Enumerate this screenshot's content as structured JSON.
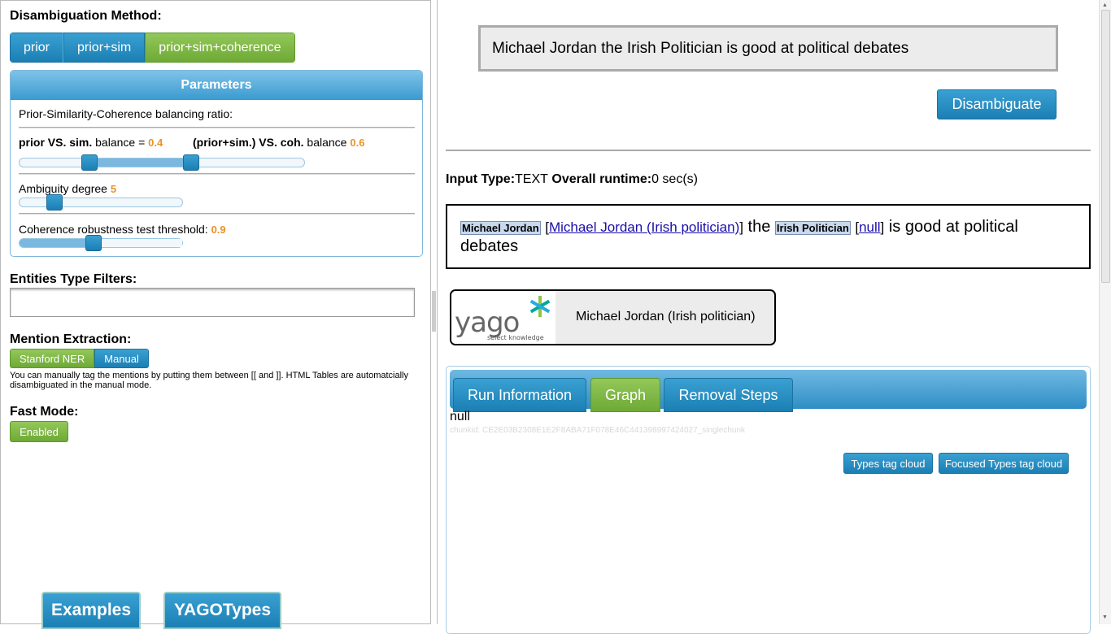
{
  "left": {
    "method_title": "Disambiguation Method:",
    "methods": [
      "prior",
      "prior+sim",
      "prior+sim+coherence"
    ],
    "params_title": "Parameters",
    "balancing_label": "Prior-Similarity-Coherence balancing ratio:",
    "prior_sim_bold": "prior VS. sim.",
    "prior_sim_rest": " balance = ",
    "prior_sim_value": "0.4",
    "coh_bold": "(prior+sim.) VS. coh.",
    "coh_rest": " balance ",
    "coh_value": "0.6",
    "ambiguity_label": "Ambiguity degree ",
    "ambiguity_value": "5",
    "coherence_label": "Coherence robustness test threshold: ",
    "coherence_value": "0.9",
    "filters_title": "Entities Type Filters:",
    "mention_title": "Mention Extraction:",
    "mention_options": [
      "Stanford NER",
      "Manual"
    ],
    "mention_note": "You can manually tag the mentions by putting them between [[ and ]]. HTML Tables are automatcially disambiguated in the manual mode.",
    "fast_title": "Fast Mode:",
    "fast_value": "Enabled",
    "examples_label": "Examples",
    "yagotypes_label": "YAGOTypes"
  },
  "right": {
    "input_text": "Michael Jordan the Irish Politician is good at political debates",
    "disambiguate_label": "Disambiguate",
    "input_type_bold": "Input Type:",
    "input_type_value": "TEXT",
    "runtime_bold": " Overall runtime:",
    "runtime_value": "0 sec(s)",
    "result": {
      "mention1": "Michael Jordan",
      "entity1": "Michael Jordan (Irish politician)",
      "text1": " the ",
      "mention2": "Irish Politician",
      "entity2": "null",
      "text2": " is good at political debates"
    },
    "yago_logo_text": "yago",
    "yago_tagline": "select knowledge",
    "yago_entity": "Michael Jordan (Irish politician)",
    "tabs": [
      "Run Information",
      "Graph",
      "Removal Steps"
    ],
    "null_text": "null",
    "chunk_text": "chunkid: CE2E03B2308E1E2F8ABA71F078E46C441398997424027_singlechunk",
    "types_cloud_label": "Types tag cloud",
    "focused_cloud_label": "Focused Types tag cloud"
  },
  "colors": {
    "blue": "#1b7fb3",
    "green": "#6ea935",
    "orange": "#e8932a"
  }
}
